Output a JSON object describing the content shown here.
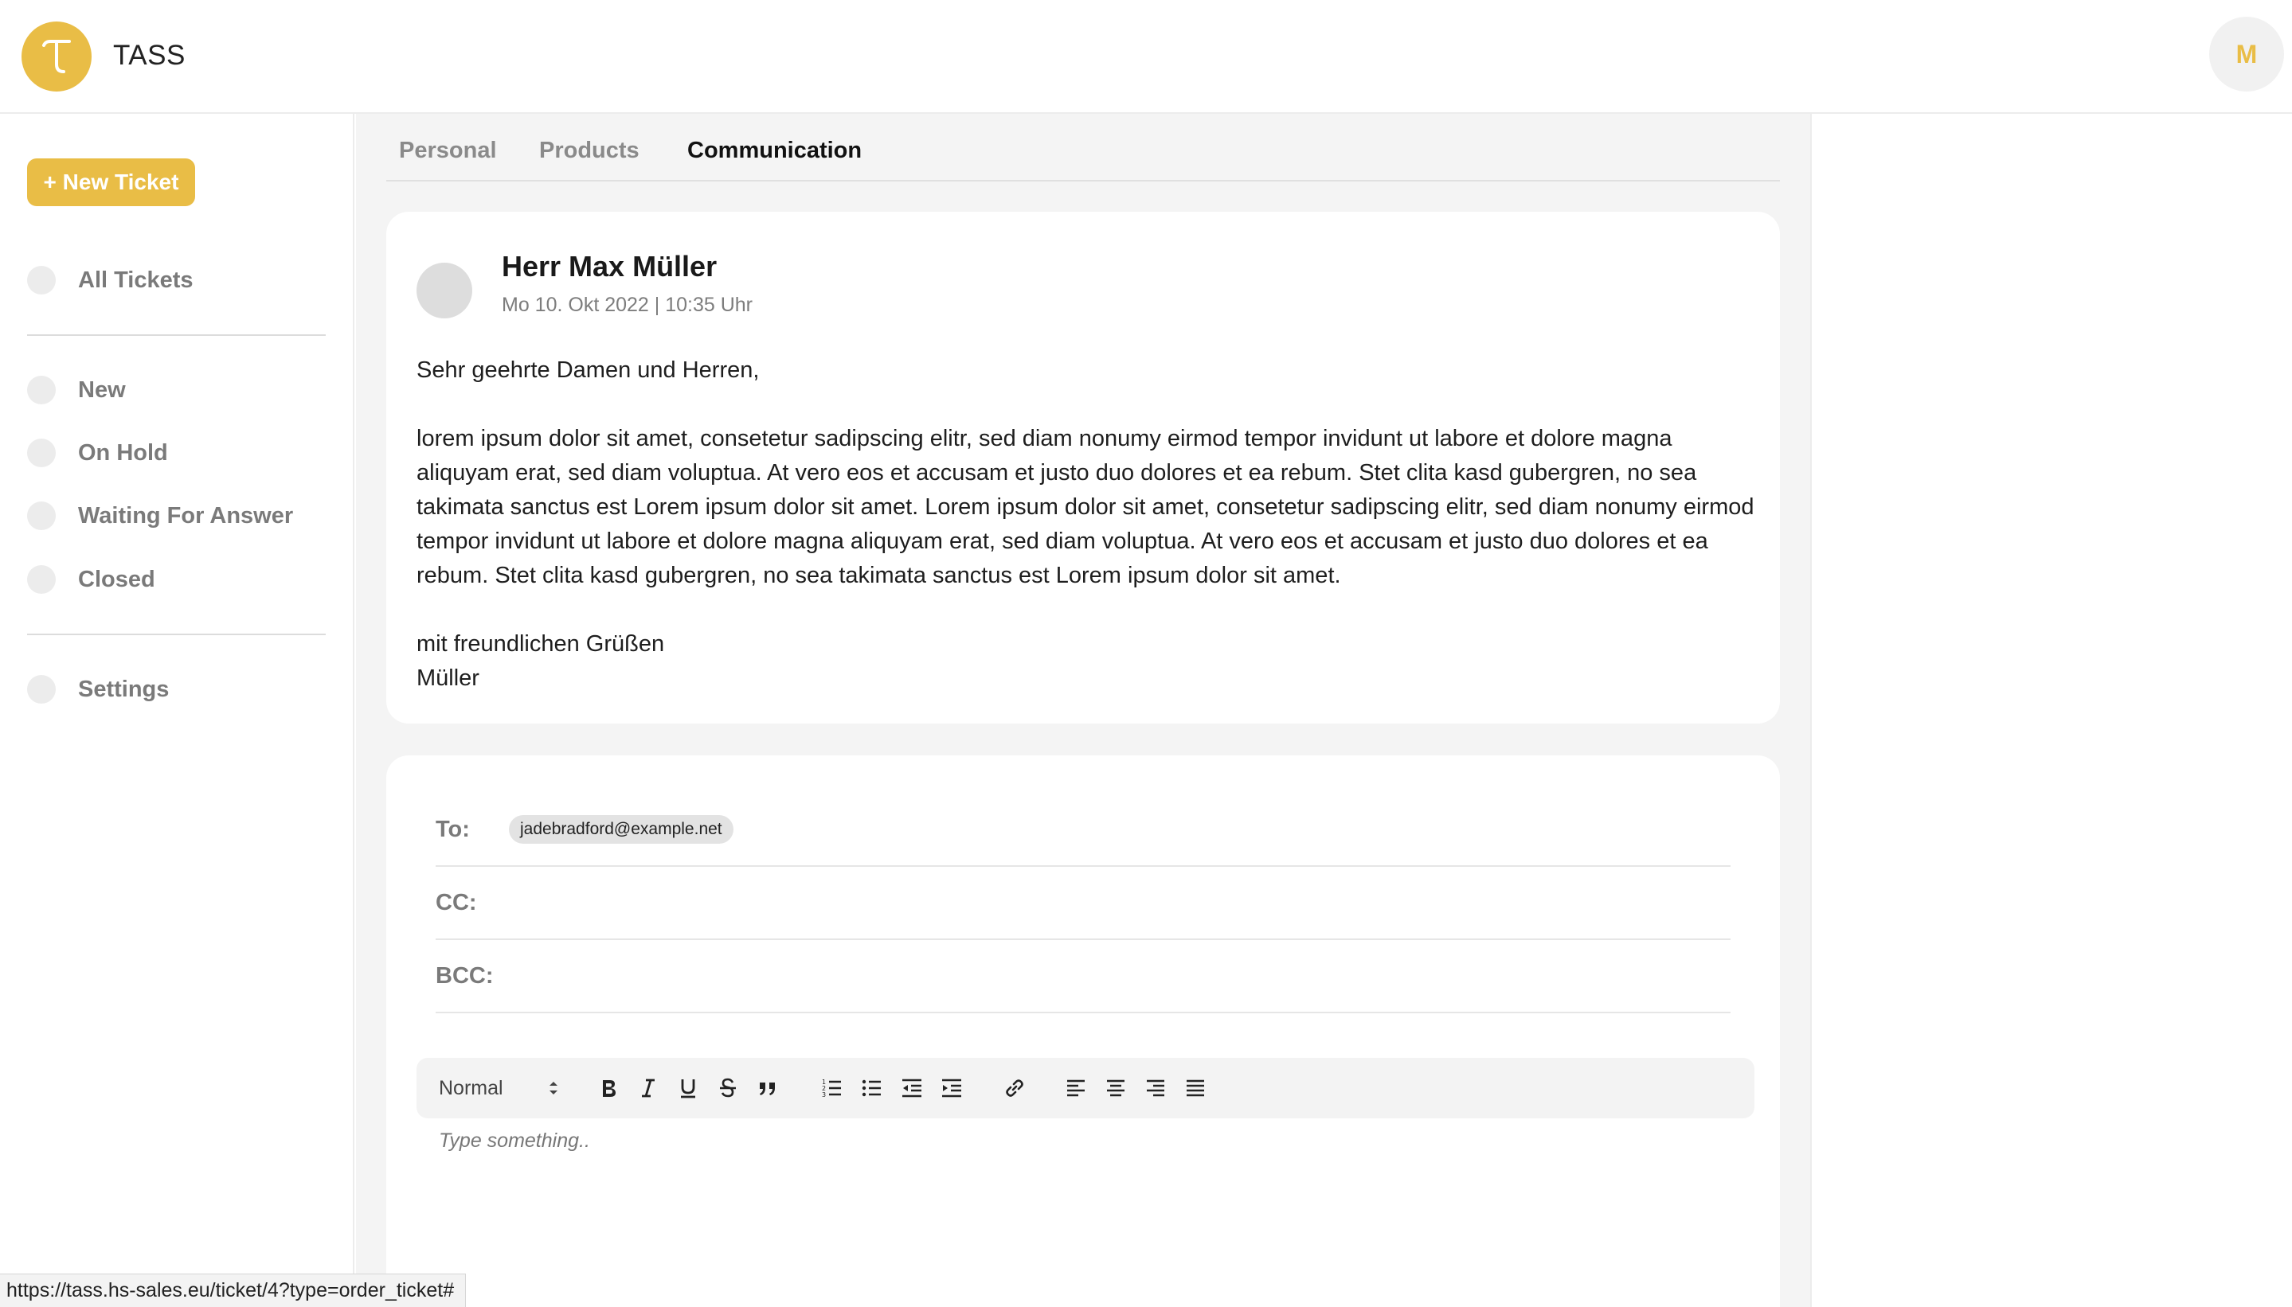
{
  "app": {
    "title": "TASS",
    "user_initial": "M"
  },
  "colors": {
    "accent": "#e9bd46",
    "sidebar_text": "#7a7a7a"
  },
  "sidebar": {
    "new_ticket_label": "+ New Ticket",
    "items": [
      {
        "label": "All Tickets"
      },
      {
        "label": "New"
      },
      {
        "label": "On Hold"
      },
      {
        "label": "Waiting For Answer"
      },
      {
        "label": "Closed"
      },
      {
        "label": "Settings"
      }
    ]
  },
  "tabs": [
    {
      "label": "Personal",
      "active": false
    },
    {
      "label": "Products",
      "active": false
    },
    {
      "label": "Communication",
      "active": true
    }
  ],
  "message": {
    "sender": "Herr Max Müller",
    "date": "Mo 10. Okt 2022 | 10:35 Uhr",
    "greeting": "Sehr geehrte Damen und Herren,",
    "body": "lorem ipsum dolor sit amet, consetetur sadipscing elitr, sed diam nonumy eirmod tempor invidunt ut labore et dolore magna aliquyam erat, sed diam voluptua. At vero eos et accusam et justo duo dolores et ea rebum. Stet clita kasd gubergren, no sea takimata sanctus est Lorem ipsum dolor sit amet. Lorem ipsum dolor sit amet, consetetur sadipscing elitr, sed diam nonumy eirmod tempor invidunt ut labore et dolore magna aliquyam erat, sed diam voluptua. At vero eos et accusam et justo duo dolores et ea rebum. Stet clita kasd gubergren, no sea takimata sanctus est Lorem ipsum dolor sit amet.",
    "closing": "mit freundlichen Grüßen",
    "signature": "Müller"
  },
  "compose": {
    "to_label": "To:",
    "to_value": "jadebradford@example.net",
    "cc_label": "CC:",
    "bcc_label": "BCC:",
    "format_select": "Normal",
    "placeholder": "Type something.."
  },
  "toolbar_icons": [
    "bold-icon",
    "italic-icon",
    "underline-icon",
    "strikethrough-icon",
    "quote-icon",
    "ordered-list-icon",
    "bullet-list-icon",
    "outdent-icon",
    "indent-icon",
    "link-icon",
    "align-left-icon",
    "align-center-icon",
    "align-right-icon",
    "align-justify-icon"
  ],
  "status_url": "https://tass.hs-sales.eu/ticket/4?type=order_ticket#"
}
